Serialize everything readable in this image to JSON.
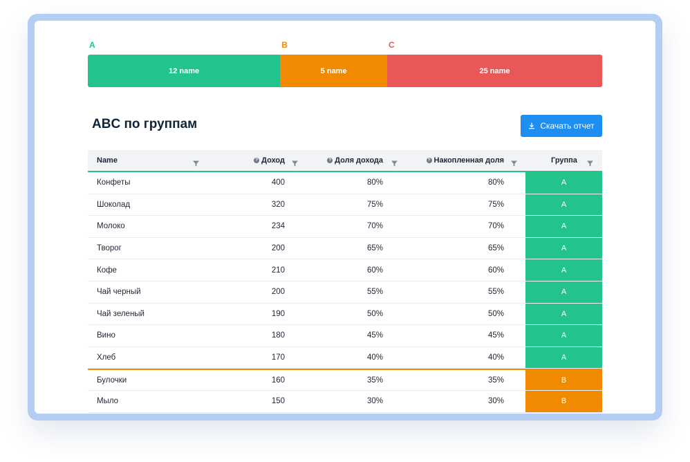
{
  "colors": {
    "a": "#22c48b",
    "b": "#f08a00",
    "c": "#ea5757",
    "accent": "#1f8ef1"
  },
  "abc_bar": {
    "segments": [
      {
        "letter": "A",
        "label": "12 name",
        "color": "#22c48b",
        "share": 0.374
      },
      {
        "letter": "B",
        "label": "5 name",
        "color": "#f08a00",
        "share": 0.208
      },
      {
        "letter": "C",
        "label": "25 name",
        "color": "#ea5757",
        "share": 0.418
      }
    ]
  },
  "page": {
    "title": "ABC по группам"
  },
  "download": {
    "label": "Скачать отчет",
    "icon": "download-icon"
  },
  "table": {
    "headers": {
      "name": "Name",
      "income": "Доход",
      "share": "Доля дохода",
      "cumulative": "Накопленная доля",
      "group": "Группа"
    },
    "rows": [
      {
        "name": "Конфеты",
        "income": "400",
        "share": "80%",
        "cumulative": "80%",
        "group": "A"
      },
      {
        "name": "Шоколад",
        "income": "320",
        "share": "75%",
        "cumulative": "75%",
        "group": "A"
      },
      {
        "name": "Молоко",
        "income": "234",
        "share": "70%",
        "cumulative": "70%",
        "group": "A"
      },
      {
        "name": "Творог",
        "income": "200",
        "share": "65%",
        "cumulative": "65%",
        "group": "A"
      },
      {
        "name": "Кофе",
        "income": "210",
        "share": "60%",
        "cumulative": "60%",
        "group": "A"
      },
      {
        "name": "Чай черный",
        "income": "200",
        "share": "55%",
        "cumulative": "55%",
        "group": "A"
      },
      {
        "name": "Чай зеленый",
        "income": "190",
        "share": "50%",
        "cumulative": "50%",
        "group": "A"
      },
      {
        "name": "Вино",
        "income": "180",
        "share": "45%",
        "cumulative": "45%",
        "group": "A"
      },
      {
        "name": "Хлеб",
        "income": "170",
        "share": "40%",
        "cumulative": "40%",
        "group": "A"
      },
      {
        "name": "Булочки",
        "income": "160",
        "share": "35%",
        "cumulative": "35%",
        "group": "B"
      },
      {
        "name": "Мыло",
        "income": "150",
        "share": "30%",
        "cumulative": "30%",
        "group": "B"
      }
    ]
  }
}
